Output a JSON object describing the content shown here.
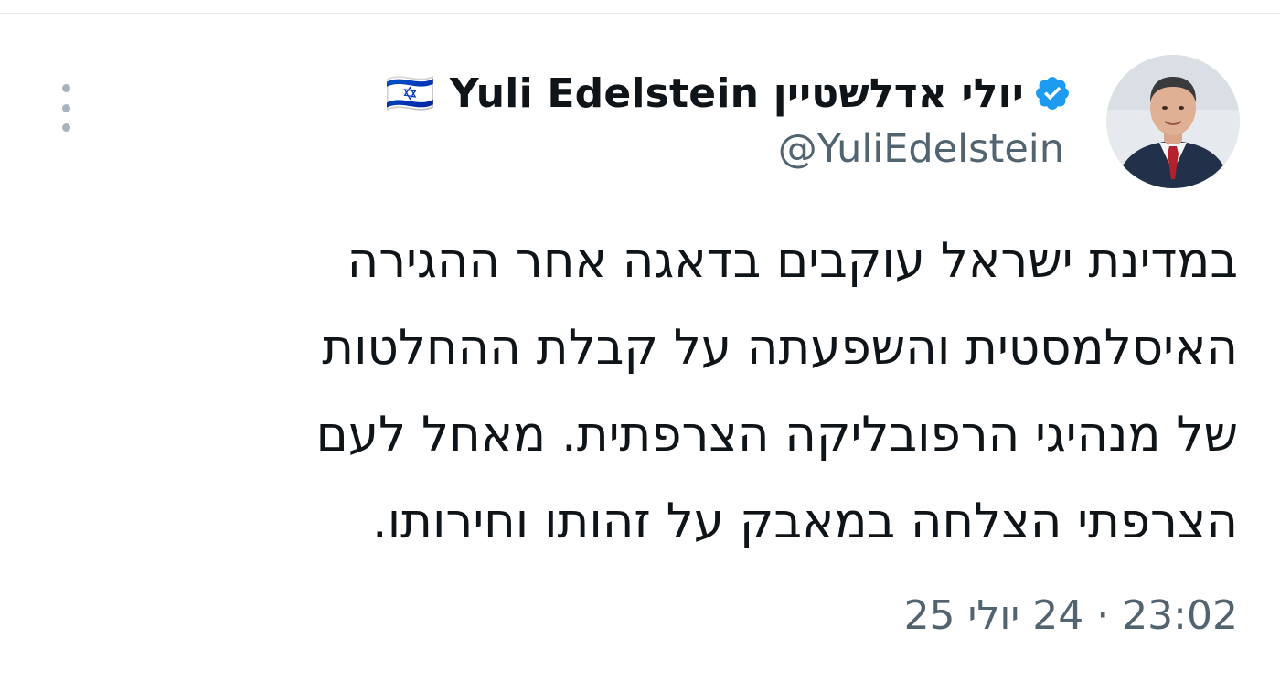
{
  "author": {
    "display_name": "יולי אדלשטיין 🇮🇱 Yuli Edelstein",
    "handle": "@YuliEdelstein",
    "verified": true,
    "verified_color": "#1d9bf0"
  },
  "tweet": {
    "lines": [
      "במדינת ישראל עוקבים בדאגה אחר ההגירה",
      "האיסלמסטית והשפעתה על קבלת ההחלטות",
      "של מנהיגי הרפובליקה הצרפתית. מאחל לעם",
      "הצרפתי הצלחה במאבק על זהותו וחירותו."
    ],
    "timestamp": "23:02 · 24 יולי 25"
  },
  "icons": {
    "more": "more-vertical-icon",
    "verified": "verified-badge-icon",
    "avatar": "profile-photo"
  },
  "colors": {
    "text": "#0f1419",
    "secondary": "#536471",
    "accent": "#1d9bf0"
  }
}
